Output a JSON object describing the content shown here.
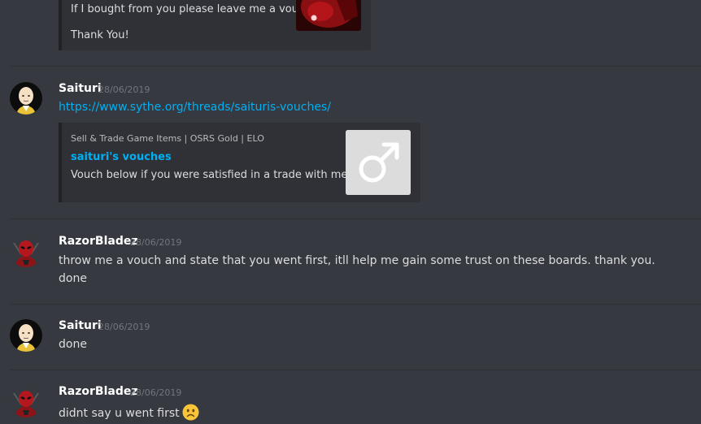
{
  "messages": [
    {
      "embed": {
        "lines": [
          "If I bought from you please leave me a vouch.",
          "Thank You!"
        ]
      }
    },
    {
      "author": "Saituri",
      "timestamp": "28/06/2019",
      "link": "https://www.sythe.org/threads/saituris-vouches/",
      "embed": {
        "provider": "Sell & Trade Game Items | OSRS Gold | ELO",
        "title": "saituri's vouches",
        "description": "Vouch below if you were satisfied in a trade with me! :D"
      }
    },
    {
      "author": "RazorBladez",
      "timestamp": "28/06/2019",
      "lines": [
        "throw me a vouch and state that you went first, itll help me gain some trust on these boards. thank you.",
        "done"
      ]
    },
    {
      "author": "Saituri",
      "timestamp": "28/06/2019",
      "lines": [
        "done"
      ]
    },
    {
      "author": "RazorBladez",
      "timestamp": "28/06/2019",
      "lines": [
        "didnt say u went first"
      ]
    }
  ],
  "icons": {
    "male_symbol": "male-symbol-icon",
    "frown_emoji": "frowning-face-emoji"
  },
  "colors": {
    "background": "#36393f",
    "embed_bg": "#2f3136",
    "link": "#00b0f4",
    "username": "#ffffff",
    "timestamp": "#72767d"
  }
}
